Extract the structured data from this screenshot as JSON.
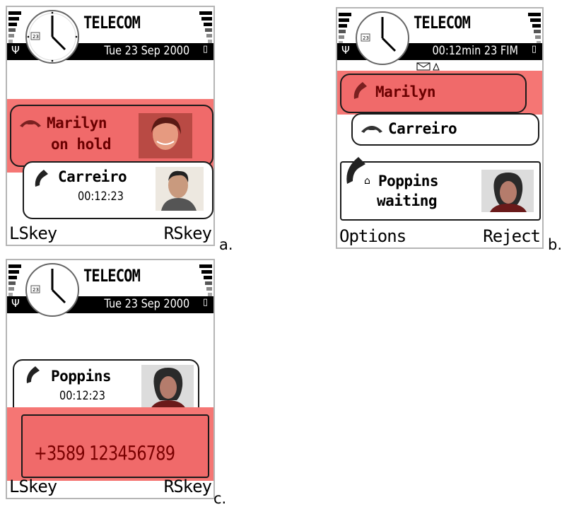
{
  "panels": {
    "a": {
      "letter": "a.",
      "carrier": "TELECOM",
      "date": "Tue 23 Sep 2000",
      "held_call": {
        "name_line1": "Marilyn",
        "name_line2": "on hold"
      },
      "active_call": {
        "name": "Carreiro",
        "duration": "00:12:23"
      },
      "left_softkey": "LSkey",
      "right_softkey": "RSkey"
    },
    "b": {
      "letter": "b.",
      "carrier": "TELECOM",
      "status_text": "00:12min 23 FIM",
      "active_call": {
        "name": "Marilyn"
      },
      "second_call": {
        "name": "Carreiro"
      },
      "waiting_call": {
        "name_line1": "Poppins",
        "name_line2": "waiting"
      },
      "left_softkey": "Options",
      "right_softkey": "Reject"
    },
    "c": {
      "letter": "c.",
      "carrier": "TELECOM",
      "date": "Tue 23 Sep 2000",
      "active_call": {
        "name": "Poppins",
        "duration": "00:12:23"
      },
      "dialed_number": "+3589 123456789",
      "left_softkey": "LSkey",
      "right_softkey": "RSkey"
    }
  },
  "colors": {
    "highlight": "#f57674",
    "dark_red_text": "#7a0000"
  }
}
